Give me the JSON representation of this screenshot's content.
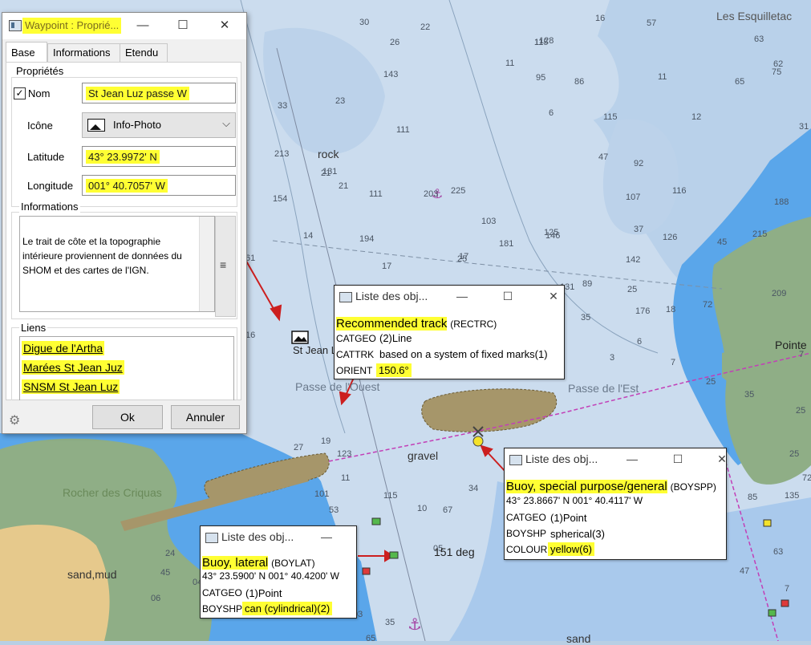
{
  "colors": {
    "highlight": "#ffff33",
    "land": "#8fae86",
    "shallow": "#87b9ea",
    "deep": "#cbdcee",
    "arrow": "#cc1f1f",
    "route": "#c23fb7"
  },
  "map": {
    "place_names": [
      "Les Esquilletac",
      "Pointe",
      "Rocher des Criquas",
      "Passe de l'Ouest",
      "Passe de l'Est"
    ],
    "seabed_labels": [
      "rock",
      "gravel",
      "sand,mud",
      "sand"
    ],
    "bearing_label": "151 deg",
    "waypoint_label": "St Jean L",
    "depths": [
      "30",
      "26",
      "22",
      "11",
      "16",
      "11",
      "62",
      "57",
      "12",
      "115",
      "128",
      "11",
      "95",
      "86",
      "6",
      "65",
      "63",
      "75",
      "31",
      "33",
      "143",
      "23",
      "213",
      "111",
      "225",
      "21",
      "111",
      "103",
      "115",
      "47",
      "92",
      "107",
      "116",
      "131",
      "154",
      "14",
      "21",
      "194",
      "203",
      "17",
      "181",
      "146",
      "89",
      "37",
      "45",
      "215",
      "188",
      "17",
      "25",
      "125",
      "126",
      "176",
      "142",
      "18",
      "25",
      "35",
      "131",
      "72",
      "16",
      "61",
      "35",
      "209",
      "25",
      "7",
      "6",
      "3",
      "25",
      "25",
      "7",
      "135",
      "85",
      "72",
      "47",
      "63",
      "7",
      "19",
      "27",
      "123",
      "11",
      "101",
      "53",
      "115",
      "10",
      "67",
      "34",
      "05",
      "24",
      "81",
      "41",
      "03",
      "65",
      "35",
      "24",
      "06",
      "45",
      "04"
    ]
  },
  "waypoint_dialog": {
    "title": "Waypoint : Proprié...",
    "window_buttons": {
      "minimize": "—",
      "maximize": "☐",
      "close": "✕"
    },
    "tabs": [
      "Base",
      "Informations",
      "Etendu"
    ],
    "properties_group": "Propriétés",
    "name_label": "Nom",
    "name_checked": true,
    "name_value": "St Jean Luz passe W",
    "icon_label": "Icône",
    "icon_value": "Info-Photo",
    "latitude_label": "Latitude",
    "latitude_value": "43° 23.9972' N",
    "longitude_label": "Longitude",
    "longitude_value": "001° 40.7057' W",
    "info_group": "Informations",
    "info_text": "Le trait de côte et la topographie intérieure proviennent de données du SHOM et des cartes de l'IGN.",
    "scroll_glyph": "≡",
    "links_group": "Liens",
    "links": [
      "Digue de l'Artha ",
      "Marées St Jean Juz",
      "SNSM St Jean Luz"
    ],
    "ok_label": "Ok",
    "cancel_label": "Annuler"
  },
  "popups": {
    "title": "Liste des obj...",
    "track": {
      "name": "Recommended track",
      "code": "(RECTRC)",
      "rows": [
        {
          "k": "CATGEO",
          "v": "(2)Line"
        },
        {
          "k": "CATTRK",
          "v": "based on a system of fixed marks(1)"
        },
        {
          "k": "ORIENT",
          "v": "150.6°"
        }
      ]
    },
    "special": {
      "name": "Buoy, special purpose/general",
      "code": "(BOYSPP)",
      "coord": "43° 23.8667' N 001° 40.4117' W",
      "rows": [
        {
          "k": "CATGEO",
          "v": "(1)Point"
        },
        {
          "k": "BOYSHP",
          "v": "spherical(3)"
        },
        {
          "k": "COLOUR",
          "v": "yellow(6)"
        }
      ]
    },
    "lateral": {
      "name": "Buoy, lateral",
      "code": "(BOYLAT)",
      "coord": "43° 23.5900' N 001° 40.4200' W",
      "rows": [
        {
          "k": "CATGEO",
          "v": "(1)Point"
        },
        {
          "k": "BOYSHP",
          "v": "can (cylindrical)(2)"
        }
      ]
    }
  }
}
